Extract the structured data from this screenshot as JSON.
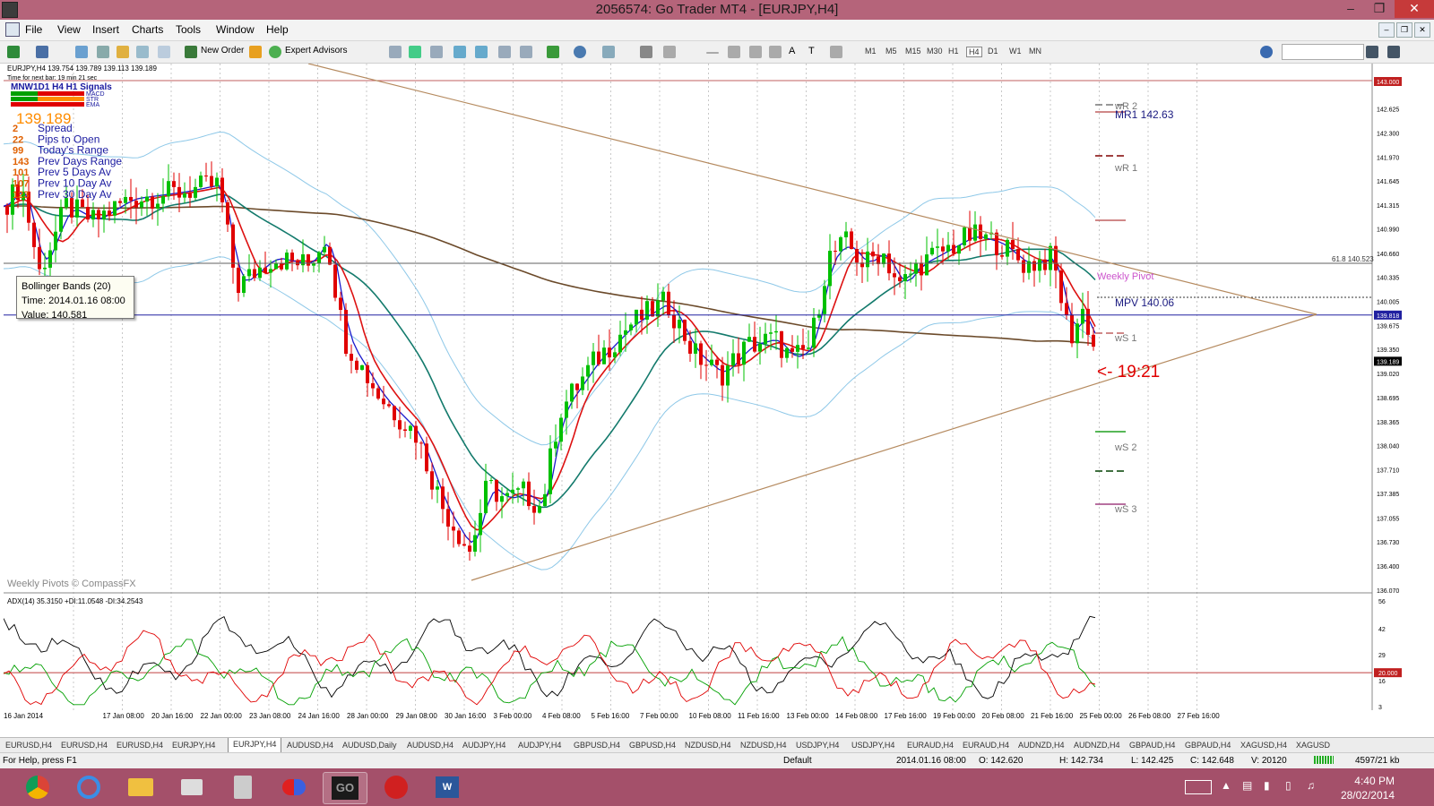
{
  "window": {
    "title": "2056574: Go Trader MT4 - [EURJPY,H4]"
  },
  "menu": [
    "File",
    "View",
    "Insert",
    "Charts",
    "Tools",
    "Window",
    "Help"
  ],
  "toolbar": {
    "new_order": "New Order",
    "expert_advisors": "Expert Advisors",
    "timeframes": [
      "M1",
      "M5",
      "M15",
      "M30",
      "H1",
      "H4",
      "D1",
      "W1",
      "MN"
    ]
  },
  "chart": {
    "header": "EURJPY,H4  139.754 139.789 139.113 139.189",
    "next_bar": "Time for next bar: 19 min 21 sec",
    "panel": {
      "title": "MNW1D1  H4  H1  Signals",
      "indicators": [
        "MACD",
        "STR",
        "EMA"
      ],
      "price": "139.189",
      "rows": [
        {
          "n": "2",
          "label": "Spread"
        },
        {
          "n": "22",
          "label": "Pips to Open"
        },
        {
          "n": "99",
          "label": "Today's Range"
        },
        {
          "n": "143",
          "label": "Prev Days Range"
        },
        {
          "n": "101",
          "label": "Prev 5 Days Av"
        },
        {
          "n": "107",
          "label": "Prev 10 Day Av"
        },
        {
          "n": "123",
          "label": "Prev 30 Day Av"
        }
      ]
    },
    "tooltip": {
      "line1": "Bollinger Bands (20)",
      "line2": "Time: 2014.01.16 08:00",
      "line3": "Value: 140.581"
    },
    "pivots": {
      "wr2": "wR 2",
      "mr1": "MR1   142.63",
      "wr1": "wR 1",
      "weekly": "Weekly Pivot",
      "mpv": "MPV   140.06",
      "ws1": "wS 1",
      "ws2": "wS 2",
      "ws3": "wS 3"
    },
    "countdown": "<- 19:21",
    "watermark": "Weekly Pivots  © CompassFX",
    "fib_label": "61.8 140.523",
    "price_axis": [
      "143.000",
      "142.625",
      "142.300",
      "141.970",
      "141.645",
      "141.315",
      "140.990",
      "140.660",
      "140.335",
      "140.005",
      "139.818",
      "139.675",
      "139.350",
      "139.189",
      "139.020",
      "138.695",
      "138.365",
      "138.040",
      "137.710",
      "137.385",
      "137.055",
      "136.730",
      "136.400",
      "136.070"
    ],
    "price_marks": {
      "red_top": "143.000",
      "blue_line": "139.818",
      "last": "139.189"
    },
    "adx_label": "ADX(14) 35.3150 +DI:11.0548 -DI:34.2543",
    "adx_axis": [
      "56",
      "42",
      "29",
      "20.000",
      "16",
      "3"
    ],
    "time_axis": [
      "16 Jan 2014",
      "17 Jan 08:00",
      "20 Jan 16:00",
      "22 Jan 00:00",
      "23 Jan 08:00",
      "24 Jan 16:00",
      "28 Jan 00:00",
      "29 Jan 08:00",
      "30 Jan 16:00",
      "3 Feb 00:00",
      "4 Feb 08:00",
      "5 Feb 16:00",
      "7 Feb 00:00",
      "10 Feb 08:00",
      "11 Feb 16:00",
      "13 Feb 00:00",
      "14 Feb 08:00",
      "17 Feb 16:00",
      "19 Feb 00:00",
      "20 Feb 08:00",
      "21 Feb 16:00",
      "25 Feb 00:00",
      "26 Feb 08:00",
      "27 Feb 16:00"
    ]
  },
  "tabs": [
    "EURUSD,H4",
    "EURUSD,H4",
    "EURUSD,H4",
    "EURJPY,H4",
    "EURJPY,H4",
    "AUDUSD,H4",
    "AUDUSD,Daily",
    "AUDUSD,H4",
    "AUDJPY,H4",
    "AUDJPY,H4",
    "GBPUSD,H4",
    "GBPUSD,H4",
    "NZDUSD,H4",
    "NZDUSD,H4",
    "USDJPY,H4",
    "USDJPY,H4",
    "EURAUD,H4",
    "EURAUD,H4",
    "AUDNZD,H4",
    "AUDNZD,H4",
    "GBPAUD,H4",
    "GBPAUD,H4",
    "XAGUSD,H4",
    "XAGUSD"
  ],
  "active_tab": 4,
  "status": {
    "help": "For Help, press F1",
    "profile": "Default",
    "time": "2014.01.16 08:00",
    "open": "O: 142.620",
    "high": "H: 142.734",
    "low": "L: 142.425",
    "close": "C: 142.648",
    "volume": "V: 20120",
    "traffic": "4597/21 kb"
  },
  "taskbar": {
    "time": "4:40 PM",
    "date": "28/02/2014"
  },
  "colors": {
    "title_bar": "#b5647a",
    "taskbar": "#a4506a",
    "bull": "#00c000",
    "bear": "#e00000",
    "ema_fast": "#1a1acc",
    "ema_mid": "#dd1111",
    "ema_slow": "#137a6c",
    "sma200": "#6b4a2a",
    "bollinger": "#8ec8e8",
    "trendline": "#b58a5f"
  }
}
